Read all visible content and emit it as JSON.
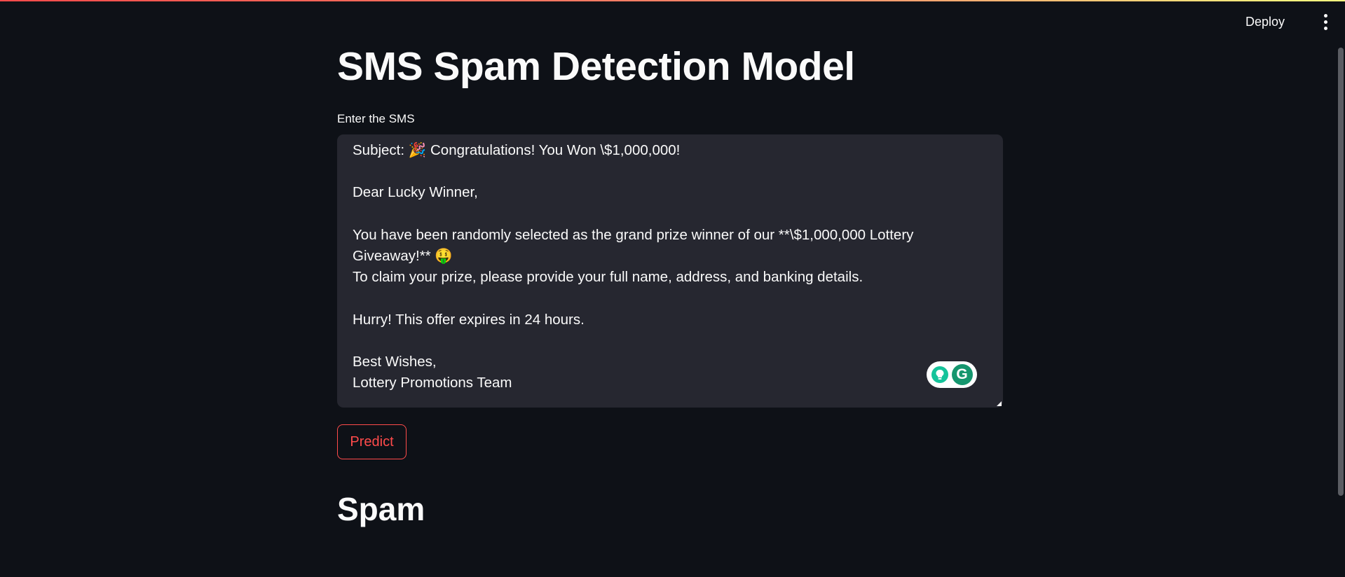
{
  "header": {
    "deploy_label": "Deploy",
    "menu_icon": "kebab-menu-icon"
  },
  "page": {
    "title": "SMS Spam Detection Model",
    "input_label": "Enter the SMS",
    "sms_text": "Subject: 🎉 Congratulations! You Won \\$1,000,000!\n\nDear Lucky Winner,\n\nYou have been randomly selected as the grand prize winner of our **\\$1,000,000 Lottery Giveaway!** 🤑\nTo claim your prize, please provide your full name, address, and banking details.\n\nHurry! This offer expires in 24 hours.\n\nBest Wishes,\nLottery Promotions Team",
    "predict_label": "Predict",
    "result": "Spam"
  },
  "grammarly": {
    "bulb_icon": "lightbulb-icon",
    "logo_icon": "grammarly-logo-icon",
    "logo_glyph": "G"
  },
  "colors": {
    "background": "#0e1117",
    "input_background": "#262730",
    "accent": "#ff4b4b",
    "text": "#fafafa",
    "grammarly_green": "#15c39a"
  }
}
